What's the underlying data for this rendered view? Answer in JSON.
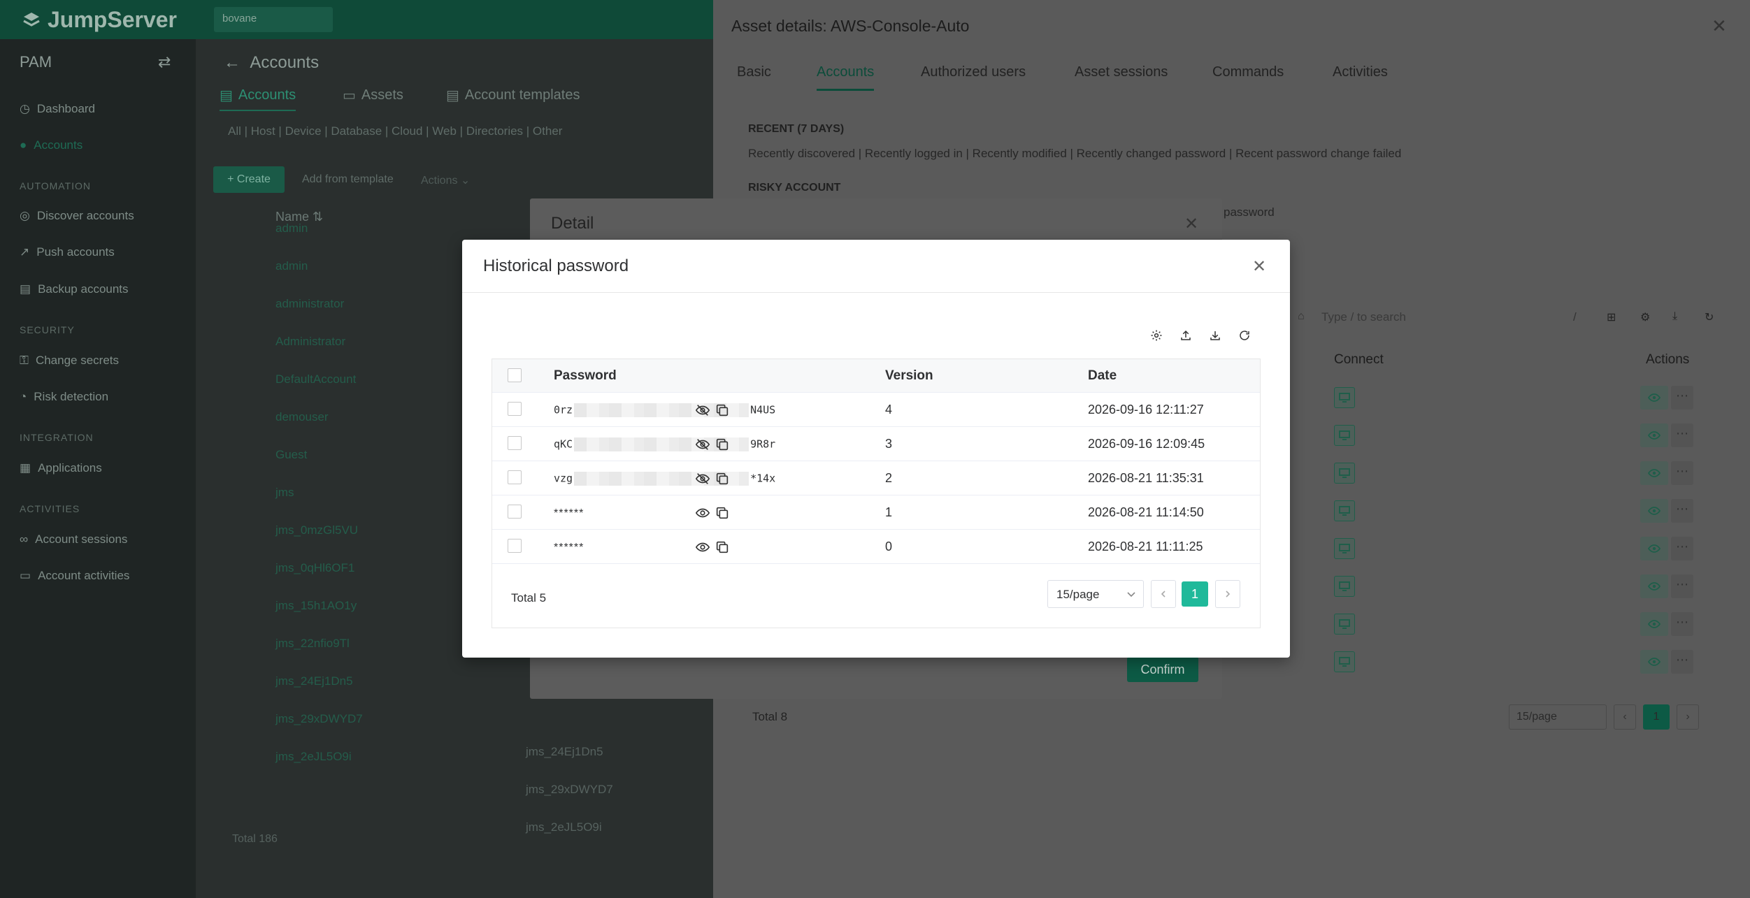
{
  "app": {
    "logo_text": "JumpServer",
    "org": "bovane"
  },
  "sidebar": {
    "header": "PAM",
    "items": [
      {
        "label": "Dashboard",
        "icon": "dashboard-icon"
      },
      {
        "label": "Accounts",
        "icon": "user-icon"
      }
    ],
    "sections": [
      {
        "title": "AUTOMATION",
        "items": [
          "Discover accounts",
          "Push accounts",
          "Backup accounts"
        ]
      },
      {
        "title": "SECURITY",
        "items": [
          "Change secrets",
          "Risk detection"
        ]
      },
      {
        "title": "INTEGRATION",
        "items": [
          "Applications"
        ]
      },
      {
        "title": "ACTIVITIES",
        "items": [
          "Account sessions",
          "Account activities"
        ]
      }
    ]
  },
  "main": {
    "title": "Accounts",
    "tabs": [
      "Accounts",
      "Assets",
      "Account templates"
    ],
    "filters": "All | Host | Device | Database | Cloud | Web | Directories | Other",
    "create_label": "+ Create",
    "from_template_label": "Add from template",
    "actions_label": "Actions",
    "name_header": "Name",
    "rows": [
      "admin",
      "admin",
      "administrator",
      "Administrator",
      "DefaultAccount",
      "demouser",
      "Guest",
      "jms",
      "jms_0mzGl5VU",
      "jms_0qHl6OF1",
      "jms_15h1AO1y",
      "jms_22nfio9Tl",
      "jms_24Ej1Dn5",
      "jms_29xDWYD7",
      "jms_2eJL5O9i"
    ],
    "usernames": [
      "jms_24Ej1Dn5",
      "jms_29xDWYD7",
      "jms_2eJL5O9i"
    ],
    "total": "Total 186"
  },
  "drawer": {
    "title": "Asset details: AWS-Console-Auto",
    "tabs": [
      "Basic",
      "Accounts",
      "Authorized users",
      "Asset sessions",
      "Commands",
      "Activities"
    ],
    "recent_label": "RECENT (7 DAYS)",
    "recent_items": "Recently discovered  |  Recently logged in  |  Recently modified  |  Recently changed password  |  Recent password change failed",
    "risky_label": "RISKY ACCOUNT",
    "risky_tail": "password",
    "search_placeholder": "Type / to search",
    "search_slash": "/",
    "connect_header": "Connect",
    "actions_header": "Actions",
    "total": "Total 8",
    "page_size": "15/page",
    "page": "1"
  },
  "detail": {
    "title": "Detail",
    "confirm_label": "Confirm"
  },
  "history": {
    "title": "Historical password",
    "columns": {
      "password": "Password",
      "version": "Version",
      "date": "Date"
    },
    "rows": [
      {
        "pw_prefix": "0rz",
        "pw_suffix": "N4US",
        "version": "4",
        "date": "2026-09-16 12:11:27",
        "revealed": true
      },
      {
        "pw_prefix": "qKC",
        "pw_suffix": "9R8r",
        "version": "3",
        "date": "2026-09-16 12:09:45",
        "revealed": true
      },
      {
        "pw_prefix": "vzg",
        "pw_suffix": "*14x",
        "version": "2",
        "date": "2026-08-21 11:35:31",
        "revealed": true
      },
      {
        "masked": "******",
        "version": "1",
        "date": "2026-08-21 11:14:50",
        "revealed": false
      },
      {
        "masked": "******",
        "version": "0",
        "date": "2026-08-21 11:11:25",
        "revealed": false
      }
    ],
    "total": "Total 5",
    "page_size": "15/page",
    "page": "1"
  },
  "colors": {
    "accent": "#1fb99a",
    "brand_dark": "#0f4a38"
  }
}
